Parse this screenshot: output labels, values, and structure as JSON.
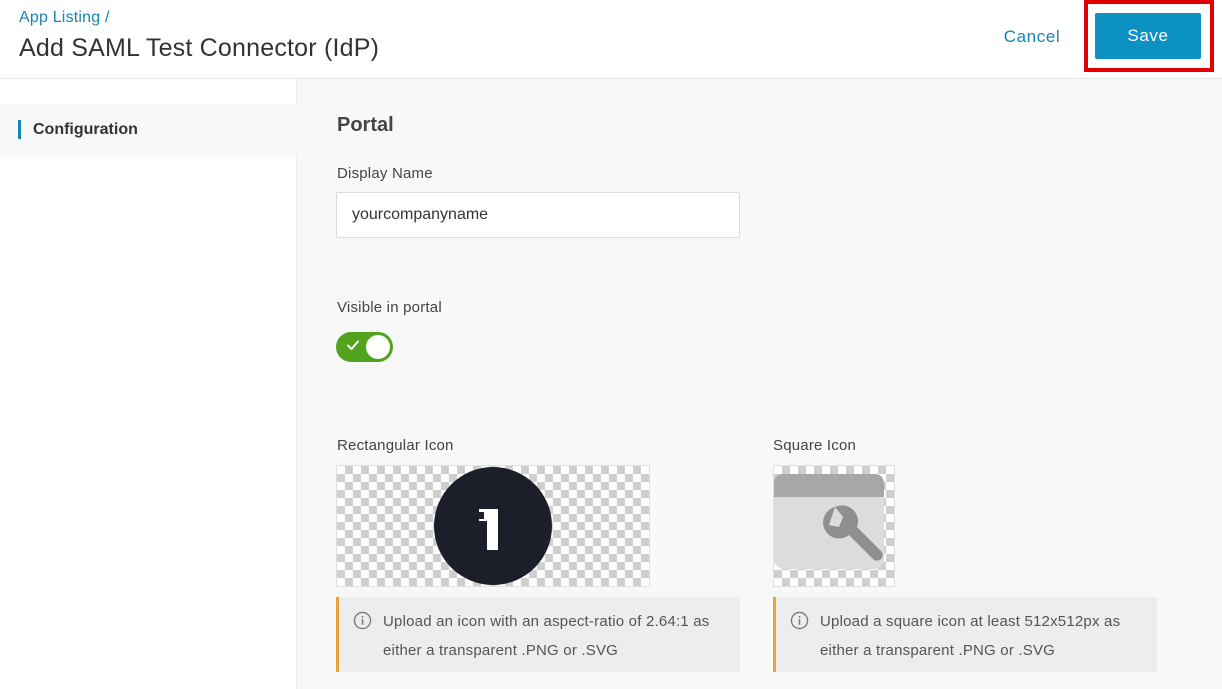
{
  "header": {
    "breadcrumb": "App Listing /",
    "title": "Add SAML Test Connector (IdP)",
    "cancel_label": "Cancel",
    "save_label": "Save"
  },
  "sidebar": {
    "items": [
      {
        "label": "Configuration",
        "active": true
      }
    ]
  },
  "portal": {
    "section_title": "Portal",
    "display_name": {
      "label": "Display Name",
      "value": "yourcompanyname"
    },
    "visible_in_portal": {
      "label": "Visible in portal",
      "enabled": true
    },
    "rectangular_icon": {
      "label": "Rectangular Icon",
      "glyph": "1",
      "info": "Upload an icon with an aspect-ratio of 2.64:1 as either a transparent .PNG or .SVG",
      "icon": "onelogin-logo"
    },
    "square_icon": {
      "label": "Square Icon",
      "info": "Upload a square icon at least 512x512px as either a transparent .PNG or .SVG",
      "icon": "wrench-window-icon"
    }
  },
  "colors": {
    "accent": "#0c91c3",
    "link": "#1685b5",
    "toggle_on": "#53a21e",
    "info_border": "#e8a33c",
    "highlight": "#e00000"
  }
}
